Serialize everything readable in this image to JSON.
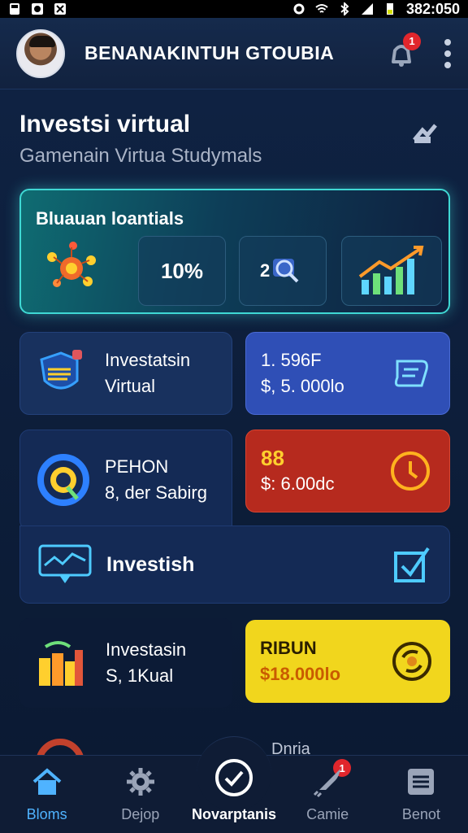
{
  "status_bar": {
    "time": "382:050"
  },
  "header": {
    "title": "BENANAKINTUH GTOUBIA",
    "notification_count": "1"
  },
  "main": {
    "title": "Investsi virtual",
    "subtitle": "Gamenain Virtua Studymals",
    "banner": {
      "title": "Bluauan loantials",
      "percent": "10%"
    },
    "cards": [
      {
        "line1": "Investatsin",
        "line2": "Virtual"
      },
      {
        "line1": "1. 596F",
        "line2": "$, 5. 000lo"
      },
      {
        "line1": "PEHON",
        "line2": "8, der Sabirg"
      },
      {
        "line1": "88",
        "line2": "$: 6.00dc"
      },
      {
        "line1": "Investish"
      },
      {
        "line1": "Investasin",
        "line2": "S, 1Kual"
      },
      {
        "line1": "RIBUN",
        "line2": "$18.000lo"
      },
      {
        "line1": "Dnria"
      }
    ]
  },
  "bottom_nav": {
    "items": [
      {
        "label": "Bloms",
        "icon": "home-icon"
      },
      {
        "label": "Dejop",
        "icon": "gear-icon"
      },
      {
        "label": "Novarptanis",
        "icon": "check-circle-icon"
      },
      {
        "label": "Camie",
        "icon": "rocket-icon",
        "badge": "1"
      },
      {
        "label": "Benot",
        "icon": "list-icon"
      }
    ]
  },
  "colors": {
    "accent": "#4fb3ff",
    "banner_border": "#3fd8d4",
    "badge": "#e0262c",
    "yellow_card": "#f1d61d",
    "red_card": "#b62a1e",
    "blue_card": "#2f4fb6"
  }
}
